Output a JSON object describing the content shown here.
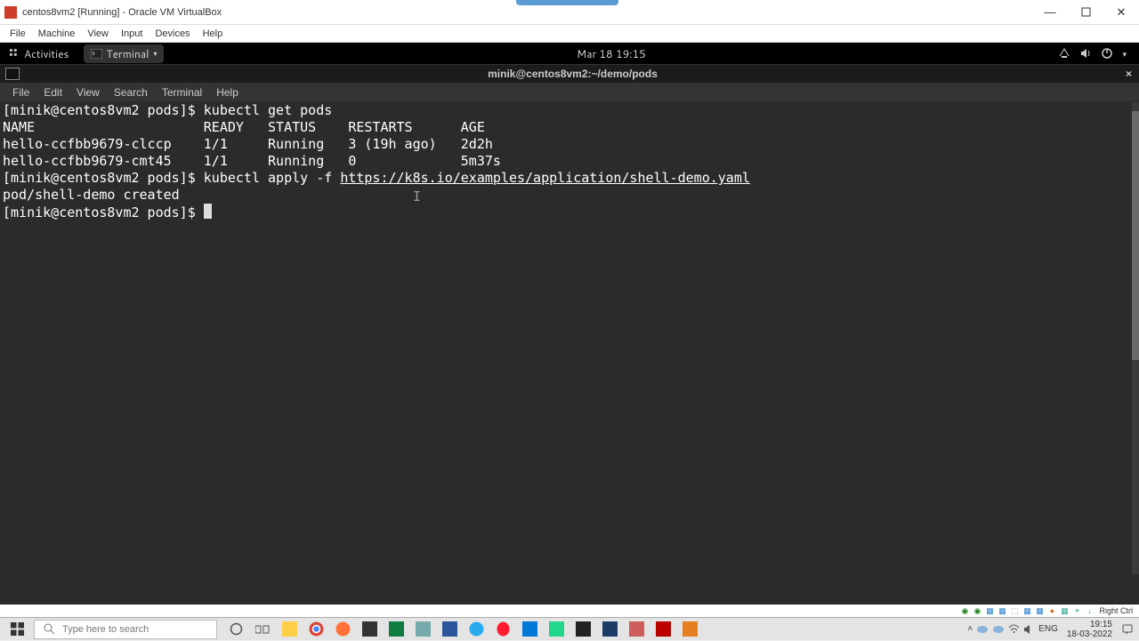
{
  "vbox": {
    "title": "centos8vm2 [Running] - Oracle VM VirtualBox",
    "menu": [
      "File",
      "Machine",
      "View",
      "Input",
      "Devices",
      "Help"
    ],
    "host_key": "Right Ctrl"
  },
  "gnome": {
    "activities": "Activities",
    "app_label": "Terminal",
    "clock": "Mar 18  19:15"
  },
  "app_window": {
    "title": "minik@centos8vm2:~/demo/pods"
  },
  "term_menu": [
    "File",
    "Edit",
    "View",
    "Search",
    "Terminal",
    "Help"
  ],
  "terminal": {
    "prompt": "[minik@centos8vm2 pods]$ ",
    "cmd1": "kubectl get pods",
    "header": "NAME                     READY   STATUS    RESTARTS      AGE",
    "rows": [
      "hello-ccfbb9679-clccp    1/1     Running   3 (19h ago)   2d2h",
      "hello-ccfbb9679-cmt45    1/1     Running   0             5m37s"
    ],
    "cmd2_pre": "kubectl apply -f ",
    "cmd2_url": "https://k8s.io/examples/application/shell-demo.yaml",
    "out2": "pod/shell-demo created"
  },
  "windows": {
    "search_placeholder": "Type here to search",
    "time": "19:15",
    "date": "18-03-2022",
    "lang": "ENG"
  }
}
